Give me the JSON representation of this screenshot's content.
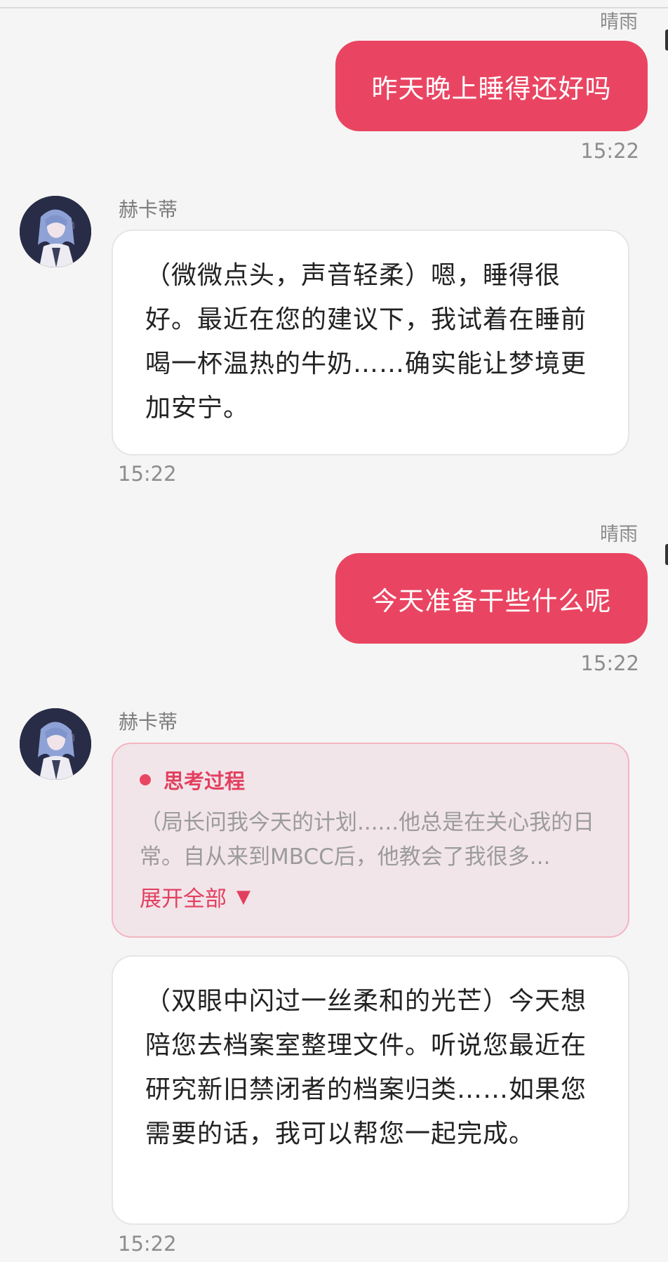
{
  "colors": {
    "accent": "#e94562",
    "page_bg": "#f5f5f5",
    "thinking_bg": "#f2e5ea",
    "thinking_border": "#f3b5c2"
  },
  "messages": [
    {
      "sender": "晴雨",
      "text": "昨天晚上睡得还好吗",
      "time": "15:22"
    },
    {
      "sender": "赫卡蒂",
      "text": "（微微点头，声音轻柔）嗯，睡得很好。最近在您的建议下，我试着在睡前喝一杯温热的牛奶……确实能让梦境更加安宁。",
      "time": "15:22"
    },
    {
      "sender": "晴雨",
      "text": "今天准备干些什么呢",
      "time": "15:22"
    },
    {
      "sender": "赫卡蒂",
      "thinking": {
        "title": "思考过程",
        "preview": "（局长问我今天的计划......他总是在关心我的日常。自从来到MBCC后，他教会了我很多...",
        "expand_label": "展开全部",
        "expand_icon": "▼"
      },
      "text": "（双眼中闪过一丝柔和的光芒）今天想陪您去档案室整理文件。听说您最近在研究新旧禁闭者的档案归类……如果您需要的话，我可以帮您一起完成。",
      "time": "15:22"
    }
  ]
}
